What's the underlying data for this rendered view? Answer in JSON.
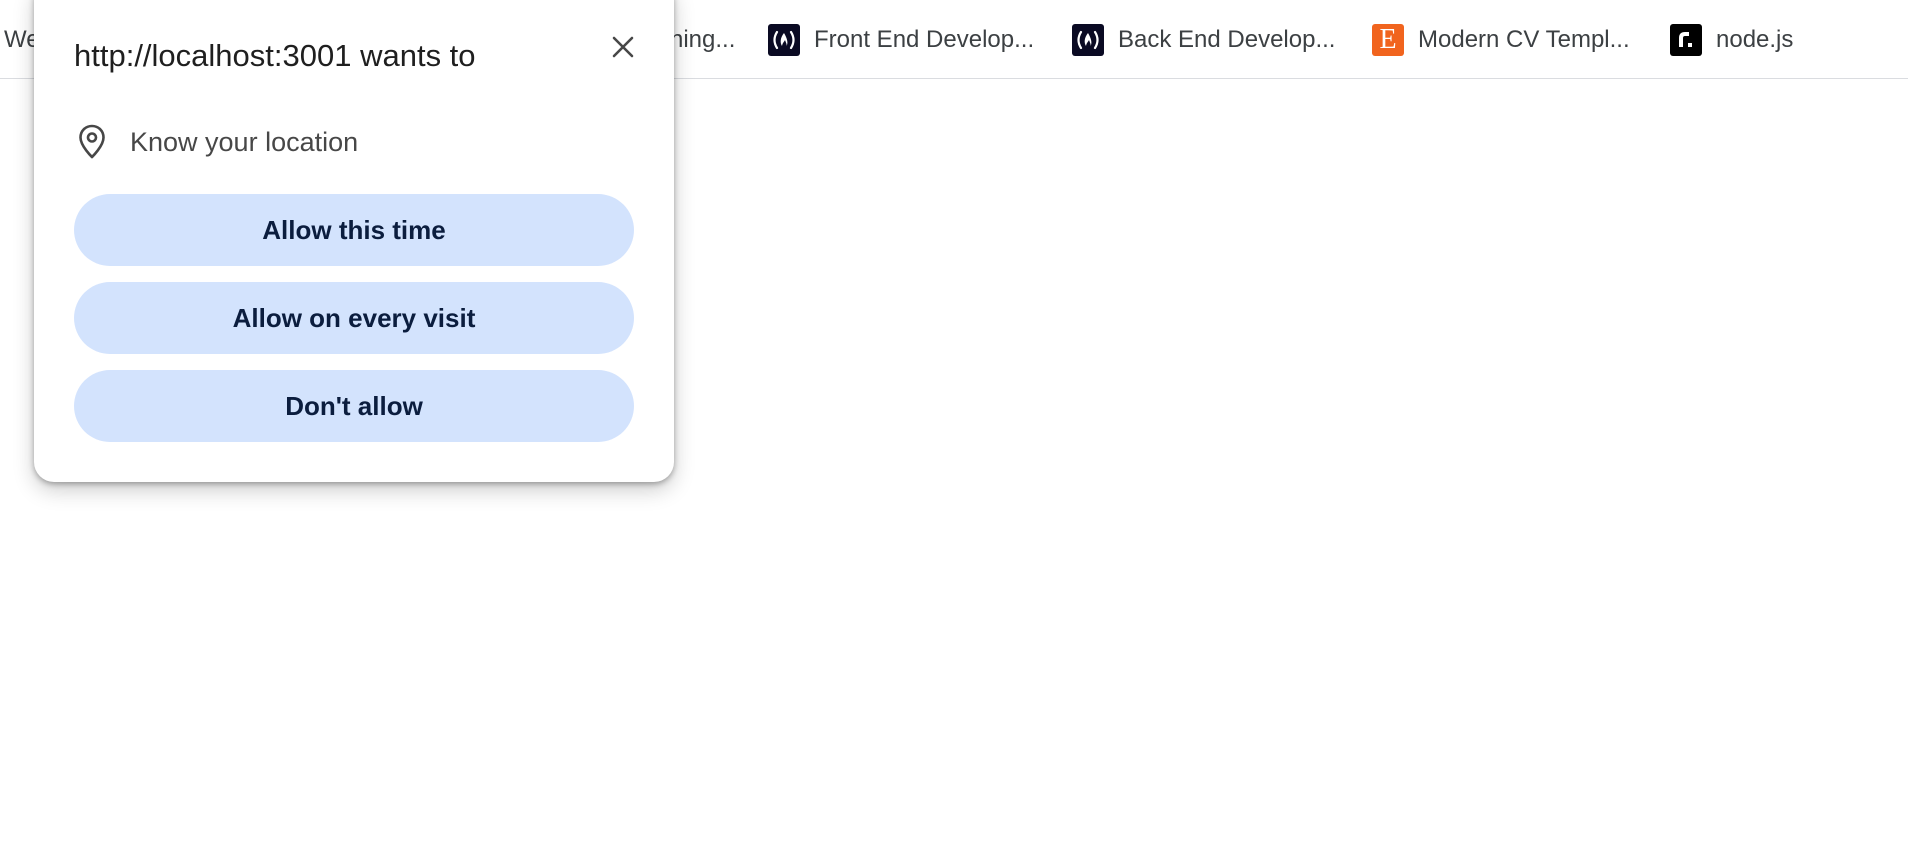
{
  "bookmarks": [
    {
      "label": "We",
      "icon": "none"
    },
    {
      "label": "ning...",
      "icon": "none"
    },
    {
      "label": "Front End Develop...",
      "icon": "freecodecamp-icon"
    },
    {
      "label": "Back End Develop...",
      "icon": "freecodecamp-icon"
    },
    {
      "label": "Modern CV Templ...",
      "icon": "etsy-icon",
      "icon_text": "E"
    },
    {
      "label": "node.js",
      "icon": "replit-r-icon"
    }
  ],
  "permission_popup": {
    "title": "http://localhost:3001 wants to",
    "permission_icon": "location-pin-icon",
    "permission_label": "Know your location",
    "buttons": [
      {
        "label": "Allow this time"
      },
      {
        "label": "Allow on every visit"
      },
      {
        "label": "Don't allow"
      }
    ],
    "close_icon": "close-icon"
  },
  "colors": {
    "button_bg": "#d3e3fd",
    "button_text": "#0b1d3e",
    "freecodecamp": "#0a0a23",
    "etsy": "#f1641e"
  }
}
